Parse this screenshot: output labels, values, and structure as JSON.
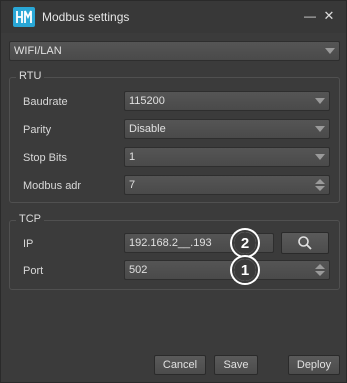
{
  "window": {
    "title": "Modbus settings",
    "minimize_glyph": "—",
    "close_glyph": "✕"
  },
  "connection": {
    "selected": "WIFI/LAN"
  },
  "rtu": {
    "label": "RTU",
    "baudrate": {
      "label": "Baudrate",
      "value": "115200"
    },
    "parity": {
      "label": "Parity",
      "value": "Disable"
    },
    "stop_bits": {
      "label": "Stop Bits",
      "value": "1"
    },
    "modbus_adr": {
      "label": "Modbus adr",
      "value": "7"
    }
  },
  "tcp": {
    "label": "TCP",
    "ip": {
      "label": "IP",
      "value": "192.168.2__.193",
      "badge": "2"
    },
    "port": {
      "label": "Port",
      "value": "502",
      "badge": "1"
    }
  },
  "buttons": {
    "cancel": "Cancel",
    "save": "Save",
    "deploy": "Deploy"
  },
  "icons": {
    "app": "hm-logo-icon",
    "search": "search-icon"
  },
  "colors": {
    "accent": "#29a7d6",
    "background": "#3b3b3b"
  }
}
